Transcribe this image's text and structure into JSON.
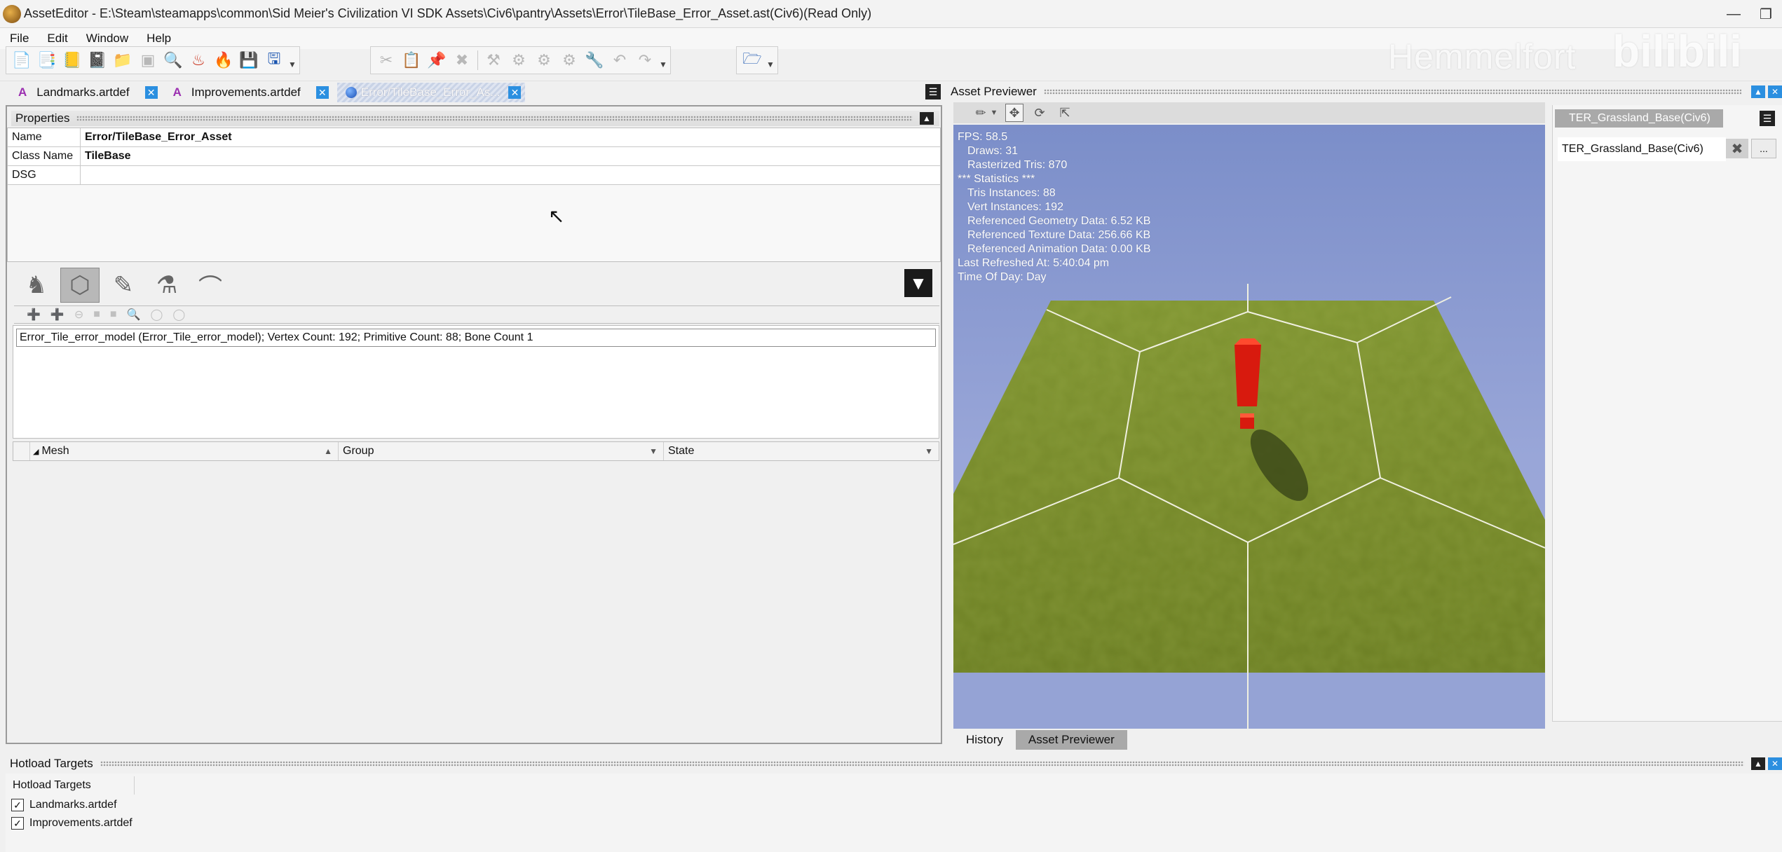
{
  "window": {
    "title": "AssetEditor - E:\\Steam\\steamapps\\common\\Sid Meier's Civilization VI SDK Assets\\Civ6\\pantry\\Assets\\Error\\TileBase_Error_Asset.ast(Civ6)(Read Only)"
  },
  "menu": [
    "File",
    "Edit",
    "Window",
    "Help"
  ],
  "watermark": {
    "text": "Hemmelfort",
    "logo": "bilibili"
  },
  "doc_tabs": [
    {
      "label": "Landmarks.artdef",
      "icon": "artdef-icon"
    },
    {
      "label": "Improvements.artdef",
      "icon": "artdef-icon"
    },
    {
      "label": "Error/TileBase_Error_As...",
      "icon": "asset-globe-icon",
      "active": true
    }
  ],
  "properties": {
    "header": "Properties",
    "rows": [
      {
        "key": "Name",
        "value": "Error/TileBase_Error_Asset"
      },
      {
        "key": "Class Name",
        "value": "TileBase"
      },
      {
        "key": "DSG",
        "value": ""
      }
    ]
  },
  "model_list": {
    "items": [
      "Error_Tile_error_model (Error_Tile_error_model); Vertex Count: 192; Primitive Count: 88; Bone Count 1"
    ]
  },
  "mesh_table": {
    "columns": [
      "Mesh",
      "Group",
      "State"
    ]
  },
  "previewer": {
    "header": "Asset Previewer",
    "stats": {
      "fps": "FPS: 58.5",
      "draws": "Draws: 31",
      "rasterized": "Rasterized Tris: 870",
      "statistics": "*** Statistics ***",
      "tris_instances": "Tris Instances: 88",
      "vert_instances": "Vert Instances: 192",
      "geometry": "Referenced Geometry Data: 6.52 KB",
      "texture": "Referenced Texture Data: 256.66 KB",
      "animation": "Referenced Animation Data: 0.00 KB",
      "refreshed": "Last Refreshed At: 5:40:04 pm",
      "time_of_day": "Time Of Day: Day"
    },
    "colors": {
      "sky": "#8fa0d4",
      "grass": "#7a8e2c",
      "marker": "#e01c10"
    }
  },
  "right_panel": {
    "tab": "TER_Grassland_Base(Civ6)",
    "field_value": "TER_Grassland_Base(Civ6)",
    "browse_label": "..."
  },
  "bottom_tabs": [
    "History",
    "Asset Previewer"
  ],
  "hotload": {
    "header": "Hotload Targets",
    "column": "Hotload Targets",
    "items": [
      {
        "label": "Landmarks.artdef",
        "checked": true
      },
      {
        "label": "Improvements.artdef",
        "checked": true
      }
    ]
  }
}
